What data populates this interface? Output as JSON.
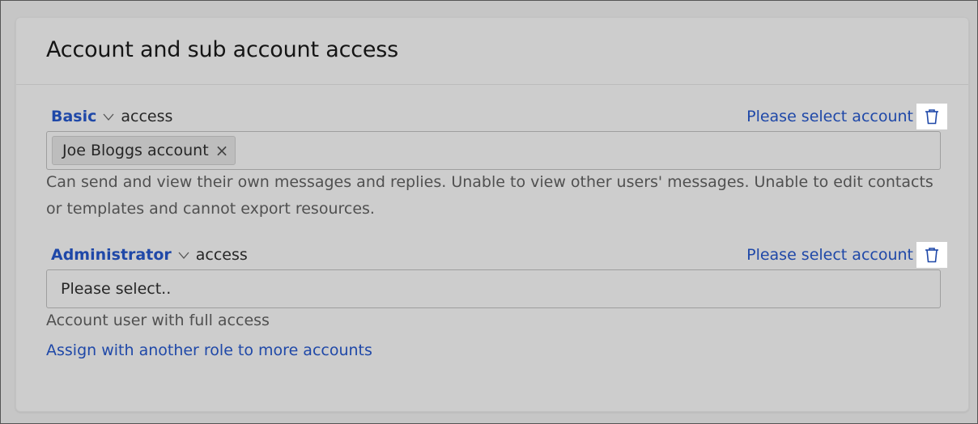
{
  "title": "Account and sub account access",
  "roles": [
    {
      "role_label": "Basic",
      "access_suffix": "access",
      "select_link": "Please select account",
      "selected_chip": "Joe Bloggs account",
      "description": "Can send and view their own messages and replies. Unable to view other users' messages. Unable to edit contacts or templates and cannot export resources."
    },
    {
      "role_label": "Administrator",
      "access_suffix": "access",
      "select_link": "Please select account",
      "placeholder": "Please select..",
      "description": "Account user with full access"
    }
  ],
  "assign_link": "Assign with another role to more accounts",
  "icons": {
    "chevron": "chevron-down-icon",
    "trash": "trash-icon",
    "chip_remove": "close-icon"
  },
  "colors": {
    "link": "#1f48a8",
    "background": "#cdcdcd"
  }
}
